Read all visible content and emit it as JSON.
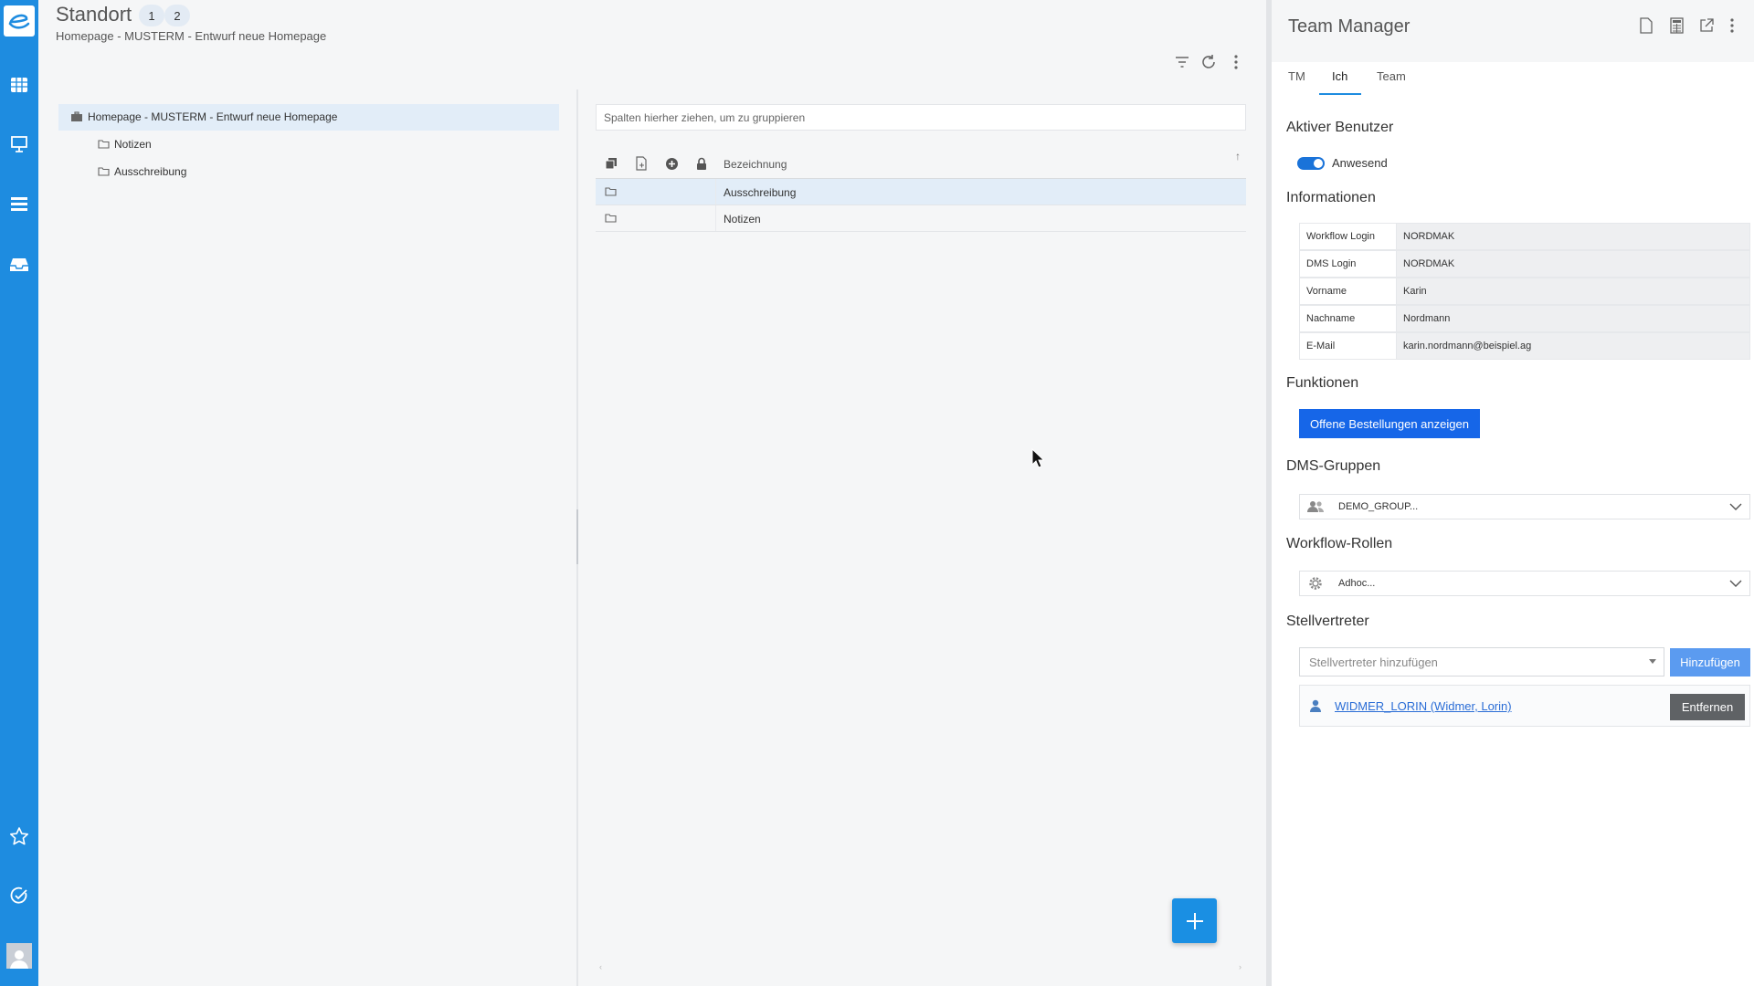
{
  "header": {
    "title": "Standort",
    "pills": [
      "1",
      "2"
    ],
    "subtitle": "Homepage - MUSTERM - Entwurf neue Homepage"
  },
  "tree": {
    "root": "Homepage - MUSTERM - Entwurf neue Homepage",
    "children": [
      "Notizen",
      "Ausschreibung"
    ]
  },
  "grid": {
    "group_placeholder": "Spalten hierher ziehen, um zu gruppieren",
    "column_label": "Bezeichnung",
    "sort_indicator": "↑",
    "rows": [
      "Ausschreibung",
      "Notizen"
    ],
    "selected_row": 0,
    "footer_marks": [
      "‹",
      "›"
    ]
  },
  "team_manager": {
    "title": "Team Manager",
    "tabs": [
      "TM",
      "Ich",
      "Team"
    ],
    "active_tab": "Ich",
    "sections": {
      "active_user": "Aktiver Benutzer",
      "info": "Informationen",
      "functions": "Funktionen",
      "dms_groups": "DMS-Gruppen",
      "workflow_roles": "Workflow-Rollen",
      "deputies": "Stellvertreter"
    },
    "presence_label": "Anwesend",
    "presence_on": true,
    "info_rows": [
      {
        "key": "Workflow Login",
        "value": "NORDMAK"
      },
      {
        "key": "DMS Login",
        "value": "NORDMAK"
      },
      {
        "key": "Vorname",
        "value": "Karin"
      },
      {
        "key": "Nachname",
        "value": "Nordmann"
      },
      {
        "key": "E-Mail",
        "value": "karin.nordmann@beispiel.ag"
      }
    ],
    "function_button": "Offene Bestellungen anzeigen",
    "dms_group_value": "DEMO_GROUP...",
    "workflow_role_value": "Adhoc...",
    "deputy_placeholder": "Stellvertreter hinzufügen",
    "add_button": "Hinzufügen",
    "deputy_name": "WIDMER_LORIN (Widmer, Lorin)",
    "remove_button": "Entfernen"
  },
  "colors": {
    "rail": "#1e8ce0",
    "primary_button": "#1666e8",
    "add_button": "#5b9bf0",
    "selection": "#e2edf8",
    "remove_button": "#5f6265"
  },
  "icons": {
    "rail": [
      "logo-icon",
      "table-icon",
      "presentation-icon",
      "list-icon",
      "inbox-icon",
      "star-icon",
      "check-circle-icon",
      "user-icon"
    ],
    "toolbar": [
      "filter-icon",
      "refresh-icon",
      "more-vertical-icon"
    ],
    "team_manager_header": [
      "document-icon",
      "calculator-icon",
      "external-link-icon",
      "more-vertical-icon"
    ]
  }
}
